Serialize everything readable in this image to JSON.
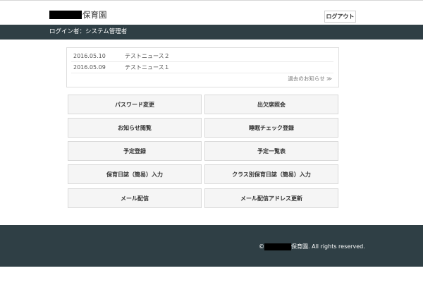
{
  "header": {
    "brand_suffix": "保育園",
    "logout_label": "ログアウト"
  },
  "userbar": {
    "label": "ログイン者：システム管理者"
  },
  "news": {
    "items": [
      {
        "date": "2016.05.10",
        "title": "テストニュース２"
      },
      {
        "date": "2016.05.09",
        "title": "テストニュース１"
      }
    ],
    "more_label": "過去のお知らせ ≫"
  },
  "menu": {
    "buttons": [
      "パスワード変更",
      "出欠席照会",
      "お知らせ閲覧",
      "睡眠チェック登録",
      "予定登録",
      "予定一覧表",
      "保育日誌（簡易）入力",
      "クラス別保育日誌（簡易）入力",
      "メール配信",
      "メール配信アドレス更新"
    ]
  },
  "footer": {
    "copyright_prefix": "©",
    "copyright_suffix": "保育園. All rights reserved."
  },
  "colors": {
    "bar": "#2f3f45",
    "button_bg": "#f5f5f5"
  }
}
